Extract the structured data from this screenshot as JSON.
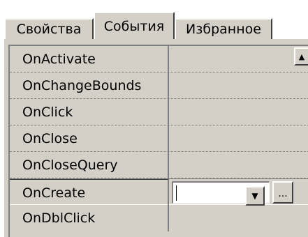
{
  "tabs": [
    {
      "label": "Свойства",
      "active": false
    },
    {
      "label": "События",
      "active": true
    },
    {
      "label": "Избранное",
      "active": false
    }
  ],
  "events": [
    {
      "name": "OnActivate",
      "value": ""
    },
    {
      "name": "OnChangeBounds",
      "value": ""
    },
    {
      "name": "OnClick",
      "value": ""
    },
    {
      "name": "OnClose",
      "value": ""
    },
    {
      "name": "OnCloseQuery",
      "value": ""
    },
    {
      "name": "OnCreate",
      "value": "",
      "selected": true
    },
    {
      "name": "OnDblClick",
      "value": ""
    }
  ],
  "editor": {
    "dropdown_glyph": "▼",
    "ellipsis_label": "..."
  },
  "scrollbar": {
    "up_glyph": "▲"
  },
  "colors": {
    "face": "#d4d0c8",
    "shadow": "#808080",
    "dark_shadow": "#404040",
    "highlight": "#ffffff"
  }
}
